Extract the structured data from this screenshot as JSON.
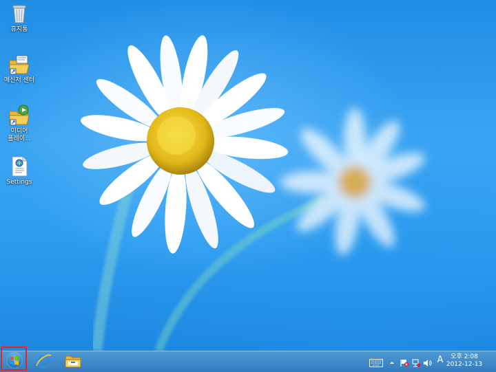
{
  "desktop": {
    "icons": [
      {
        "label": "휴지통",
        "icon": "recycle-bin-icon"
      },
      {
        "label": "메신저 센터",
        "icon": "messenger-folder-icon"
      },
      {
        "label": "미디어 플레이...",
        "icon": "media-player-folder-icon"
      },
      {
        "label": "Settings",
        "icon": "settings-document-icon"
      }
    ]
  },
  "taskbar": {
    "start": {
      "icon": "windows-start-orb-icon"
    },
    "pinned": [
      {
        "icon": "internet-explorer-icon"
      },
      {
        "icon": "file-explorer-icon"
      }
    ],
    "tray": {
      "keyboard_icon": "touch-keyboard-icon",
      "show_hidden_icon": "chevron-up-icon",
      "flag_icon": "action-center-flag-icon",
      "network_icon": "network-icon",
      "volume_icon": "speaker-icon",
      "ime": "A",
      "time": "오후 2:08",
      "date": "2012-12-13"
    }
  }
}
